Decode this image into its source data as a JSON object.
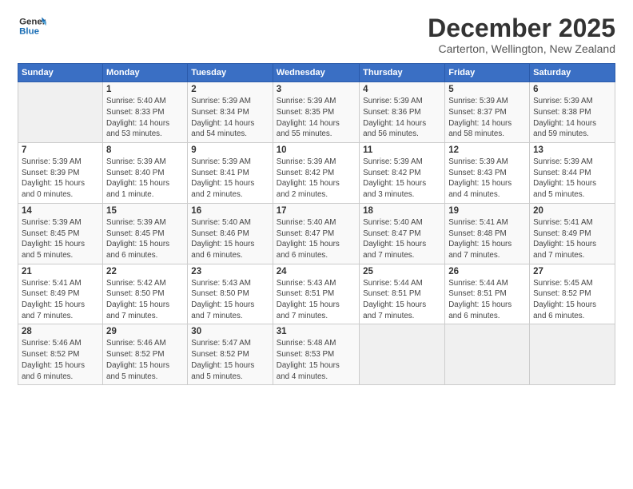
{
  "logo": {
    "line1": "General",
    "line2": "Blue"
  },
  "title": "December 2025",
  "subtitle": "Carterton, Wellington, New Zealand",
  "weekdays": [
    "Sunday",
    "Monday",
    "Tuesday",
    "Wednesday",
    "Thursday",
    "Friday",
    "Saturday"
  ],
  "weeks": [
    [
      {
        "day": "",
        "info": ""
      },
      {
        "day": "1",
        "info": "Sunrise: 5:40 AM\nSunset: 8:33 PM\nDaylight: 14 hours\nand 53 minutes."
      },
      {
        "day": "2",
        "info": "Sunrise: 5:39 AM\nSunset: 8:34 PM\nDaylight: 14 hours\nand 54 minutes."
      },
      {
        "day": "3",
        "info": "Sunrise: 5:39 AM\nSunset: 8:35 PM\nDaylight: 14 hours\nand 55 minutes."
      },
      {
        "day": "4",
        "info": "Sunrise: 5:39 AM\nSunset: 8:36 PM\nDaylight: 14 hours\nand 56 minutes."
      },
      {
        "day": "5",
        "info": "Sunrise: 5:39 AM\nSunset: 8:37 PM\nDaylight: 14 hours\nand 58 minutes."
      },
      {
        "day": "6",
        "info": "Sunrise: 5:39 AM\nSunset: 8:38 PM\nDaylight: 14 hours\nand 59 minutes."
      }
    ],
    [
      {
        "day": "7",
        "info": "Sunrise: 5:39 AM\nSunset: 8:39 PM\nDaylight: 15 hours\nand 0 minutes."
      },
      {
        "day": "8",
        "info": "Sunrise: 5:39 AM\nSunset: 8:40 PM\nDaylight: 15 hours\nand 1 minute."
      },
      {
        "day": "9",
        "info": "Sunrise: 5:39 AM\nSunset: 8:41 PM\nDaylight: 15 hours\nand 2 minutes."
      },
      {
        "day": "10",
        "info": "Sunrise: 5:39 AM\nSunset: 8:42 PM\nDaylight: 15 hours\nand 2 minutes."
      },
      {
        "day": "11",
        "info": "Sunrise: 5:39 AM\nSunset: 8:42 PM\nDaylight: 15 hours\nand 3 minutes."
      },
      {
        "day": "12",
        "info": "Sunrise: 5:39 AM\nSunset: 8:43 PM\nDaylight: 15 hours\nand 4 minutes."
      },
      {
        "day": "13",
        "info": "Sunrise: 5:39 AM\nSunset: 8:44 PM\nDaylight: 15 hours\nand 5 minutes."
      }
    ],
    [
      {
        "day": "14",
        "info": "Sunrise: 5:39 AM\nSunset: 8:45 PM\nDaylight: 15 hours\nand 5 minutes."
      },
      {
        "day": "15",
        "info": "Sunrise: 5:39 AM\nSunset: 8:45 PM\nDaylight: 15 hours\nand 6 minutes."
      },
      {
        "day": "16",
        "info": "Sunrise: 5:40 AM\nSunset: 8:46 PM\nDaylight: 15 hours\nand 6 minutes."
      },
      {
        "day": "17",
        "info": "Sunrise: 5:40 AM\nSunset: 8:47 PM\nDaylight: 15 hours\nand 6 minutes."
      },
      {
        "day": "18",
        "info": "Sunrise: 5:40 AM\nSunset: 8:47 PM\nDaylight: 15 hours\nand 7 minutes."
      },
      {
        "day": "19",
        "info": "Sunrise: 5:41 AM\nSunset: 8:48 PM\nDaylight: 15 hours\nand 7 minutes."
      },
      {
        "day": "20",
        "info": "Sunrise: 5:41 AM\nSunset: 8:49 PM\nDaylight: 15 hours\nand 7 minutes."
      }
    ],
    [
      {
        "day": "21",
        "info": "Sunrise: 5:41 AM\nSunset: 8:49 PM\nDaylight: 15 hours\nand 7 minutes."
      },
      {
        "day": "22",
        "info": "Sunrise: 5:42 AM\nSunset: 8:50 PM\nDaylight: 15 hours\nand 7 minutes."
      },
      {
        "day": "23",
        "info": "Sunrise: 5:43 AM\nSunset: 8:50 PM\nDaylight: 15 hours\nand 7 minutes."
      },
      {
        "day": "24",
        "info": "Sunrise: 5:43 AM\nSunset: 8:51 PM\nDaylight: 15 hours\nand 7 minutes."
      },
      {
        "day": "25",
        "info": "Sunrise: 5:44 AM\nSunset: 8:51 PM\nDaylight: 15 hours\nand 7 minutes."
      },
      {
        "day": "26",
        "info": "Sunrise: 5:44 AM\nSunset: 8:51 PM\nDaylight: 15 hours\nand 6 minutes."
      },
      {
        "day": "27",
        "info": "Sunrise: 5:45 AM\nSunset: 8:52 PM\nDaylight: 15 hours\nand 6 minutes."
      }
    ],
    [
      {
        "day": "28",
        "info": "Sunrise: 5:46 AM\nSunset: 8:52 PM\nDaylight: 15 hours\nand 6 minutes."
      },
      {
        "day": "29",
        "info": "Sunrise: 5:46 AM\nSunset: 8:52 PM\nDaylight: 15 hours\nand 5 minutes."
      },
      {
        "day": "30",
        "info": "Sunrise: 5:47 AM\nSunset: 8:52 PM\nDaylight: 15 hours\nand 5 minutes."
      },
      {
        "day": "31",
        "info": "Sunrise: 5:48 AM\nSunset: 8:53 PM\nDaylight: 15 hours\nand 4 minutes."
      },
      {
        "day": "",
        "info": ""
      },
      {
        "day": "",
        "info": ""
      },
      {
        "day": "",
        "info": ""
      }
    ]
  ]
}
